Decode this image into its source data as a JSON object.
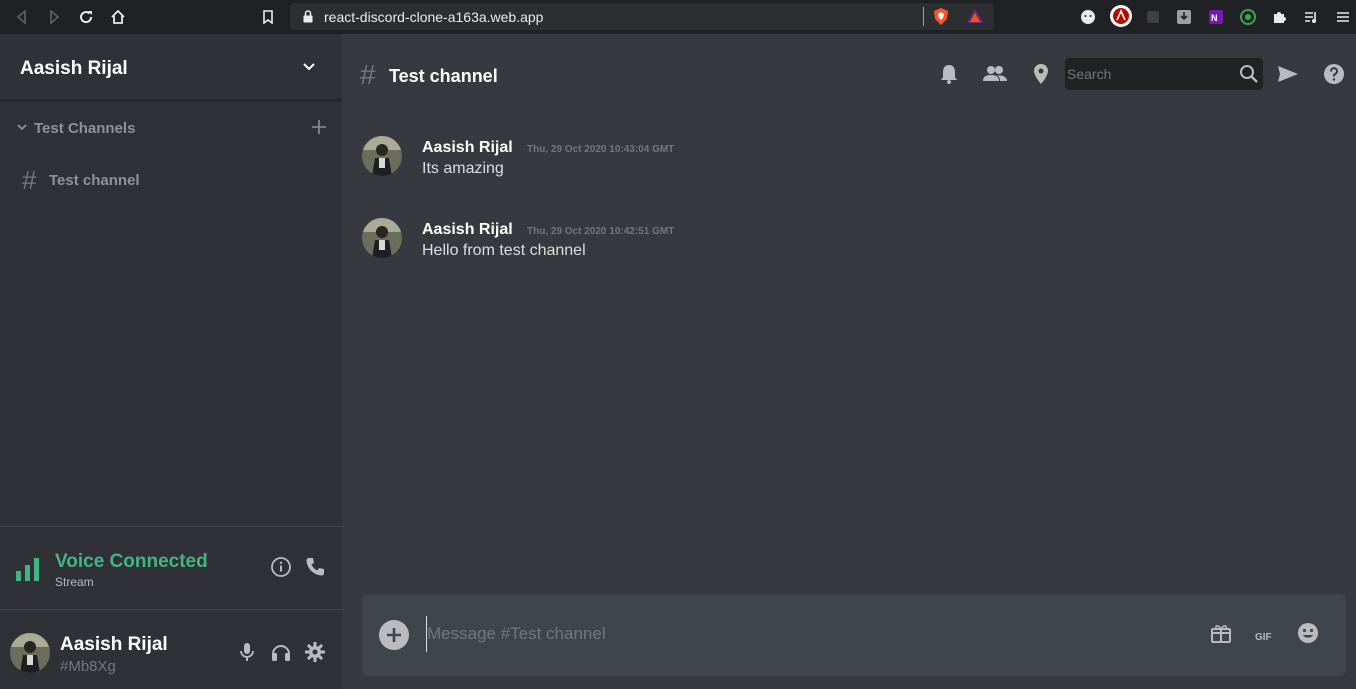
{
  "browser": {
    "url": "react-discord-clone-a163a.web.app"
  },
  "sidebar": {
    "server_name": "Aasish Rijal",
    "category": "Test Channels",
    "channels": [
      {
        "label": "Test channel"
      }
    ],
    "voice": {
      "status": "Voice Connected",
      "subtitle": "Stream",
      "status_color": "#43b581"
    },
    "user": {
      "name": "Aasish Rijal",
      "tag": "#Mb8Xg"
    }
  },
  "header": {
    "channel_name": "Test channel",
    "search_placeholder": "Search"
  },
  "messages": [
    {
      "author": "Aasish Rijal",
      "timestamp": "Thu, 29 Oct 2020 10:43:04 GMT",
      "text": "Its amazing"
    },
    {
      "author": "Aasish Rijal",
      "timestamp": "Thu, 29 Oct 2020 10:42:51 GMT",
      "text": "Hello from test channel"
    }
  ],
  "composer": {
    "placeholder": "Message #Test channel",
    "gif_label": "GIF"
  },
  "colors": {
    "sidebar_bg": "#2f3136",
    "main_bg": "#36393f",
    "accent_green": "#43b581"
  }
}
